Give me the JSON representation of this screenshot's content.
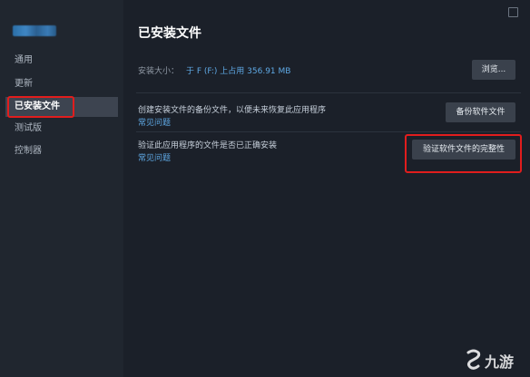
{
  "sidebar": {
    "items": [
      {
        "label": "通用"
      },
      {
        "label": "更新"
      },
      {
        "label": "已安装文件"
      },
      {
        "label": "测试版"
      },
      {
        "label": "控制器"
      }
    ]
  },
  "main": {
    "title": "已安装文件",
    "install_size_label": "安装大小：",
    "install_size_value": "于 F (F:) 上占用 356.91 MB",
    "browse_button": "浏览...",
    "backup_row": {
      "text": "创建安装文件的备份文件，以便未来恢复此应用程序",
      "link": "常见问题",
      "button": "备份软件文件"
    },
    "verify_row": {
      "text": "验证此应用程序的文件是否已正确安装",
      "link": "常见问题",
      "button": "验证软件文件的完整性"
    }
  },
  "watermark": {
    "text": "九游"
  },
  "colors": {
    "accent_link": "#5fa9e5",
    "highlight": "#e11d1d",
    "background": "#1b2029",
    "sidebar": "#20262f"
  }
}
